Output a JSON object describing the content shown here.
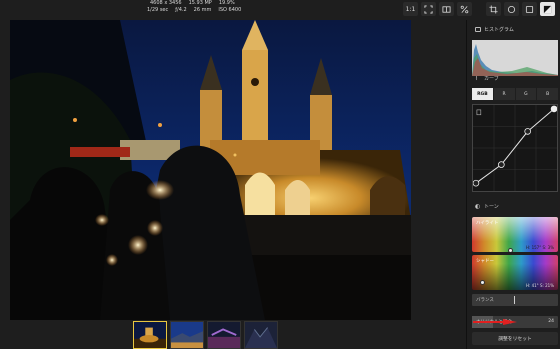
{
  "image_info": {
    "dimensions": "4608 x 3456",
    "megapixels": "15.93 MP",
    "percent": "19.9%",
    "shutter": "1/29 sec",
    "aperture": "ƒ/4.2",
    "focal": "26 mm",
    "iso": "ISO 6400"
  },
  "toolbar": {
    "zoom_label": "1:1",
    "icons": [
      "fit-icon",
      "split-icon",
      "percent-icon",
      "crop-icon",
      "circle-icon",
      "rectangle-icon",
      "adjust-icon"
    ]
  },
  "panel": {
    "histogram_title": "ヒストグラム",
    "curve_title": "カーブ",
    "curve_tabs": [
      "RGB",
      "R",
      "G",
      "B"
    ],
    "tone_title": "トーン",
    "highlight_label": "ハイライト",
    "highlight_value": "H: 157° S: 3%",
    "shadow_label": "シャドー",
    "shadow_value": "H: 41° S: 21%",
    "balance_label": "バランス",
    "blend_label": "オリジナルと混合",
    "blend_value": "24",
    "reset_label": "調整をリセット"
  },
  "colors": {
    "accent": "#e8c640",
    "arrow": "#e02020",
    "panel_bg": "#1e1e1e"
  }
}
